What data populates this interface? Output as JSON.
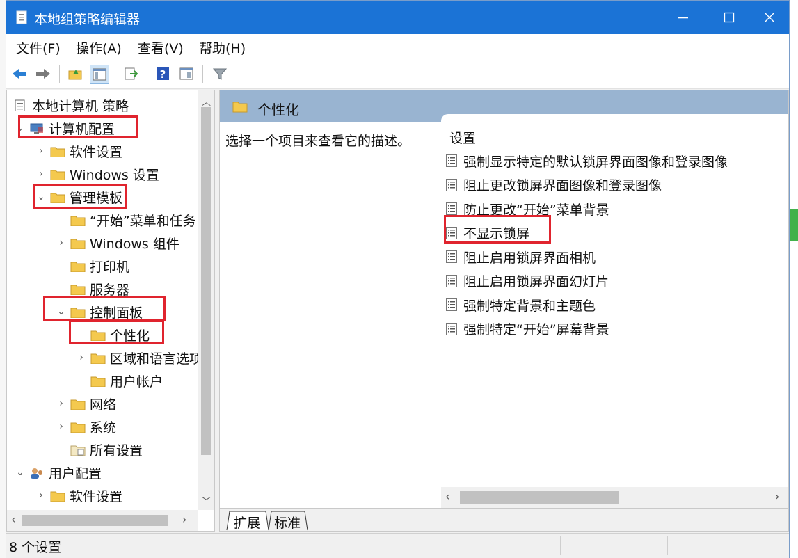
{
  "window": {
    "title": "本地组策略编辑器",
    "controls": {
      "minimize": "—",
      "maximize": "☐",
      "close": "✕"
    }
  },
  "menubar": [
    {
      "label": "文件(F)"
    },
    {
      "label": "操作(A)"
    },
    {
      "label": "查看(V)"
    },
    {
      "label": "帮助(H)"
    }
  ],
  "toolbar": {
    "items": [
      "back-arrow-icon",
      "forward-arrow-icon",
      "up-folder-icon",
      "show-hide-tree-icon",
      "export-list-icon",
      "help-icon",
      "properties-icon",
      "filter-icon"
    ]
  },
  "tree": {
    "items": [
      {
        "label": "本地计算机 策略",
        "level": 0,
        "expander": "",
        "icon": "policy-icon"
      },
      {
        "label": "计算机配置",
        "level": 1,
        "expander": "⌄",
        "icon": "computer-icon"
      },
      {
        "label": "软件设置",
        "level": 2,
        "expander": "›",
        "icon": "folder-icon"
      },
      {
        "label": "Windows 设置",
        "level": 2,
        "expander": "›",
        "icon": "folder-icon"
      },
      {
        "label": "管理模板",
        "level": 2,
        "expander": "⌄",
        "icon": "folder-icon"
      },
      {
        "label": "“开始”菜单和任务",
        "level": 3,
        "expander": "",
        "icon": "folder-icon"
      },
      {
        "label": "Windows 组件",
        "level": 3,
        "expander": "›",
        "icon": "folder-icon"
      },
      {
        "label": "打印机",
        "level": 3,
        "expander": "",
        "icon": "folder-icon"
      },
      {
        "label": "服务器",
        "level": 3,
        "expander": "",
        "icon": "folder-icon"
      },
      {
        "label": "控制面板",
        "level": 3,
        "expander": "⌄",
        "icon": "folder-icon"
      },
      {
        "label": "个性化",
        "level": 4,
        "expander": "",
        "icon": "folder-icon",
        "selected": true
      },
      {
        "label": "区域和语言选项",
        "level": 4,
        "expander": "›",
        "icon": "folder-icon"
      },
      {
        "label": "用户帐户",
        "level": 4,
        "expander": "",
        "icon": "folder-icon"
      },
      {
        "label": "网络",
        "level": 3,
        "expander": "›",
        "icon": "folder-icon"
      },
      {
        "label": "系统",
        "level": 3,
        "expander": "›",
        "icon": "folder-icon"
      },
      {
        "label": "所有设置",
        "level": 3,
        "expander": "",
        "icon": "all-settings-icon"
      },
      {
        "label": "用户配置",
        "level": 1,
        "expander": "⌄",
        "icon": "user-icon"
      },
      {
        "label": "软件设置",
        "level": 2,
        "expander": "›",
        "icon": "folder-icon"
      }
    ]
  },
  "details": {
    "header_title": "个性化",
    "description": "选择一个项目来查看它的描述。",
    "settings_header": "设置",
    "settings": [
      "强制显示特定的默认锁屏界面图像和登录图像",
      "阻止更改锁屏界面图像和登录图像",
      "防止更改“开始”菜单背景",
      "不显示锁屏",
      "阻止启用锁屏界面相机",
      "阻止启用锁屏界面幻灯片",
      "强制特定背景和主题色",
      "强制特定“开始”屏幕背景"
    ],
    "tabs": [
      "扩展",
      "标准"
    ],
    "active_tab": "扩展"
  },
  "statusbar": {
    "text": "8 个设置"
  },
  "colors": {
    "titlebar": "#1b73d6",
    "header_band": "#99b4d1",
    "annotation_red": "#e0242e",
    "folder": "#f4c94e"
  }
}
